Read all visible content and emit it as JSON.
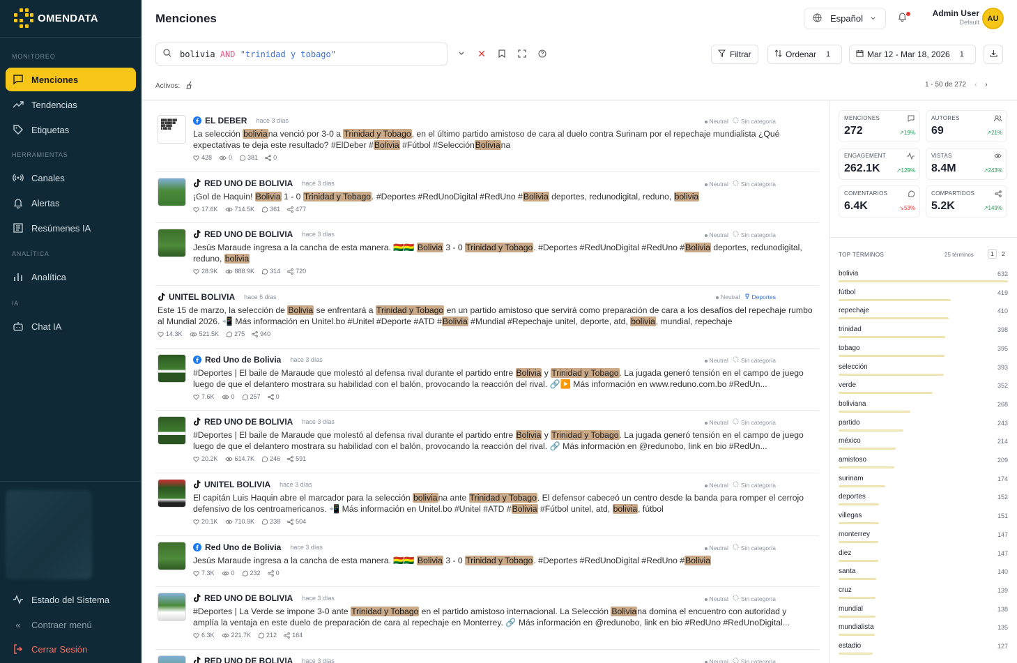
{
  "app": {
    "name": "OMENDATA"
  },
  "sidebar": {
    "sections": [
      {
        "label": "MONITOREO",
        "items": [
          {
            "label": "Menciones",
            "icon": "message-square-icon",
            "active": true
          },
          {
            "label": "Tendencias",
            "icon": "trending-up-icon"
          },
          {
            "label": "Etiquetas",
            "icon": "tag-icon"
          }
        ]
      },
      {
        "label": "HERRAMIENTAS",
        "items": [
          {
            "label": "Canales",
            "icon": "radio-icon"
          },
          {
            "label": "Alertas",
            "icon": "bell-icon"
          },
          {
            "label": "Resúmenes IA",
            "icon": "document-icon"
          }
        ]
      },
      {
        "label": "ANALÍTICA",
        "items": [
          {
            "label": "Analítica",
            "icon": "bar-chart-icon"
          }
        ]
      },
      {
        "label": "IA",
        "items": [
          {
            "label": "Chat IA",
            "icon": "robot-icon"
          }
        ]
      }
    ],
    "bottom": {
      "status": "Estado del Sistema",
      "collapse": "Contraer menú",
      "logout": "Cerrar Sesión"
    }
  },
  "header": {
    "title": "Menciones",
    "language": "Español",
    "user": {
      "name": "Admin User",
      "role": "Default",
      "initials": "AU"
    }
  },
  "search": {
    "query_parts": [
      {
        "text": "bolivia ",
        "kind": "term"
      },
      {
        "text": "AND",
        "kind": "keyword"
      },
      {
        "text": " \"trinidad y tobago\"",
        "kind": "string"
      }
    ],
    "filter": {
      "label": "Filtrar"
    },
    "sort": {
      "label": "Ordenar",
      "count": "1"
    },
    "date": {
      "label": "Mar 12 - Mar 18, 2026",
      "count": "1"
    },
    "active_label": "Activos:",
    "pagination": "1 - 50 de 272"
  },
  "posts": [
    {
      "author": "EL DEBER",
      "platform": "facebook",
      "time": "hace 3 días",
      "sentiment": "Neutral",
      "category": "Sin categoría",
      "text": "La selección [[bolivia]]na venció por 3-0 a [[Trinidad y Tobago]], en el último partido amistoso de cara al duelo contra Surinam por el repechaje mundialista ¿Qué expectativas te deja este resultado? #ElDeber #[[Bolivia]] #Fútbol #Selección[[Bolivia]]na",
      "likes": "428",
      "views": "0",
      "comments": "381",
      "shares": "0"
    },
    {
      "author": "RED UNO DE BOLIVIA",
      "platform": "tiktok",
      "time": "hace 3 días",
      "sentiment": "Neutral",
      "category": "Sin categoría",
      "text": "¡Gol de Haquin! [[Bolivia]] 1 - 0 [[Trinidad y Tobago]]. #Deportes #RedUnoDigital #RedUno #[[Bolivia]] deportes, redunodigital, reduno, [[bolivia]]",
      "likes": "17.6K",
      "views": "714.5K",
      "comments": "361",
      "shares": "477"
    },
    {
      "author": "RED UNO DE BOLIVIA",
      "platform": "tiktok",
      "time": "hace 3 días",
      "sentiment": "Neutral",
      "category": "Sin categoría",
      "text": "Jesús Maraude ingresa a la cancha de esta manera. 🇧🇴🇧🇴 [[Bolivia]] 3 - 0 [[Trinidad y Tobago]]. #Deportes #RedUnoDigital #RedUno #[[Bolivia]] deportes, redunodigital, reduno, [[bolivia]]",
      "likes": "28.9K",
      "views": "888.9K",
      "comments": "314",
      "shares": "720"
    },
    {
      "author": "UNITEL BOLIVIA",
      "platform": "tiktok",
      "time": "hace 6 días",
      "sentiment": "Neutral",
      "category": "Deportes",
      "text": "Este 15 de marzo, la selección de [[Bolivia]] se enfrentará a [[Trinidad y Tobago]] en un partido amistoso que servirá como preparación de cara a los desafíos del repechaje rumbo al Mundial 2026. 📲 Más información en Unitel.bo #Unitel #Deporte #ATD #[[Bolivia]] #Mundial #Repechaje unitel, deporte, atd, [[bolivia]], mundial, repechaje",
      "likes": "14.3K",
      "views": "521.5K",
      "comments": "275",
      "shares": "940"
    },
    {
      "author": "Red Uno de Bolivia",
      "platform": "facebook",
      "time": "hace 3 días",
      "sentiment": "Neutral",
      "category": "Sin categoría",
      "text": "#Deportes | El baile de Maraude que molestó al defensa rival durante el partido entre [[Bolivia]] y [[Trinidad y Tobago]]. La jugada generó tensión en el campo de juego luego de que el delantero mostrara su habilidad con el balón, provocando la reacción del rival. 🔗▶️ Más información en www.reduno.com.bo #RedUn...",
      "likes": "7.6K",
      "views": "0",
      "comments": "257",
      "shares": "0"
    },
    {
      "author": "RED UNO DE BOLIVIA",
      "platform": "tiktok",
      "time": "hace 3 días",
      "sentiment": "Neutral",
      "category": "Sin categoría",
      "text": "#Deportes | El baile de Maraude que molestó al defensa rival durante el partido entre [[Bolivia]] y [[Trinidad y Tobago]]. La jugada generó tensión en el campo de juego luego de que el delantero mostrara su habilidad con el balón, provocando la reacción del rival. 🔗 Más información en @redunobo, link en bio #RedUn...",
      "likes": "20.2K",
      "views": "614.7K",
      "comments": "246",
      "shares": "591"
    },
    {
      "author": "UNITEL BOLIVIA",
      "platform": "tiktok",
      "time": "hace 3 días",
      "sentiment": "Neutral",
      "category": "Sin categoría",
      "text": "El capitán Luis Haquin abre el marcador para la selección [[bolivia]]na ante [[Trinidad y Tobago]]. El defensor cabeceó un centro desde la banda para romper el cerrojo defensivo de los centroamericanos. 📲 Más información en Unitel.bo #Unitel #ATD #[[Bolivia]] #Fútbol unitel, atd, [[bolivia]], fútbol",
      "likes": "20.1K",
      "views": "710.9K",
      "comments": "238",
      "shares": "504"
    },
    {
      "author": "Red Uno de Bolivia",
      "platform": "facebook",
      "time": "hace 3 días",
      "sentiment": "Neutral",
      "category": "Sin categoría",
      "text": "Jesús Maraude ingresa a la cancha de esta manera. 🇧🇴🇧🇴 [[Bolivia]] 3 - 0 [[Trinidad y Tobago]]. #Deportes #RedUnoDigital #RedUno #[[Bolivia]]",
      "likes": "7.3K",
      "views": "0",
      "comments": "232",
      "shares": "0"
    },
    {
      "author": "RED UNO DE BOLIVIA",
      "platform": "tiktok",
      "time": "hace 3 días",
      "sentiment": "Neutral",
      "category": "Sin categoría",
      "text": "#Deportes | La Verde se impone 3-0 ante [[Trinidad y Tobago]] en el partido amistoso internacional. La Selección [[Bolivia]]na domina el encuentro con autoridad y amplía la ventaja en este duelo de preparación de cara al repechaje en Monterrey. 🔗 Más información en @redunobo, link en bio #RedUno #RedUnoDigital...",
      "likes": "6.3K",
      "views": "221.7K",
      "comments": "212",
      "shares": "164"
    },
    {
      "author": "RED UNO DE BOLIVIA",
      "platform": "tiktok",
      "time": "hace 3 días",
      "sentiment": "Neutral",
      "category": "Sin categoría",
      "text": "",
      "likes": "",
      "views": "",
      "comments": "",
      "shares": ""
    }
  ],
  "stats": [
    {
      "label": "MENCIONES",
      "value": "272",
      "delta": "↗19%",
      "trend": "up",
      "icon": "message-icon"
    },
    {
      "label": "AUTORES",
      "value": "69",
      "delta": "↗21%",
      "trend": "up",
      "icon": "users-icon"
    },
    {
      "label": "ENGAGEMENT",
      "value": "262.1K",
      "delta": "↗129%",
      "trend": "up",
      "icon": "activity-icon"
    },
    {
      "label": "VISTAS",
      "value": "8.4M",
      "delta": "↗243%",
      "trend": "up",
      "icon": "eye-icon"
    },
    {
      "label": "COMENTARIOS",
      "value": "6.4K",
      "delta": "↘53%",
      "trend": "down",
      "icon": "comment-icon"
    },
    {
      "label": "COMPARTIDOS",
      "value": "5.2K",
      "delta": "↗149%",
      "trend": "up",
      "icon": "share-icon"
    }
  ],
  "top_terms": {
    "title": "TOP TÉRMINOS",
    "count": "25 términos",
    "pages": [
      "1",
      "2"
    ],
    "items": [
      {
        "term": "bolivia",
        "count": 632
      },
      {
        "term": "fútbol",
        "count": 419
      },
      {
        "term": "repechaje",
        "count": 410
      },
      {
        "term": "trinidad",
        "count": 398
      },
      {
        "term": "tobago",
        "count": 395
      },
      {
        "term": "selección",
        "count": 393
      },
      {
        "term": "verde",
        "count": 352
      },
      {
        "term": "boliviana",
        "count": 268
      },
      {
        "term": "partido",
        "count": 243
      },
      {
        "term": "méxico",
        "count": 214
      },
      {
        "term": "amistoso",
        "count": 209
      },
      {
        "term": "surinam",
        "count": 174
      },
      {
        "term": "deportes",
        "count": 152
      },
      {
        "term": "villegas",
        "count": 151
      },
      {
        "term": "monterrey",
        "count": 147
      },
      {
        "term": "diez",
        "count": 147
      },
      {
        "term": "santa",
        "count": 140
      },
      {
        "term": "cruz",
        "count": 139
      },
      {
        "term": "mundial",
        "count": 138
      },
      {
        "term": "mundialista",
        "count": 135
      },
      {
        "term": "estadio",
        "count": 127
      }
    ]
  },
  "colors": {
    "accent": "#f5c518",
    "sidebar": "#0f2a36",
    "highlight": "#c9a988",
    "up": "#1f9d55",
    "down": "#e53935"
  }
}
